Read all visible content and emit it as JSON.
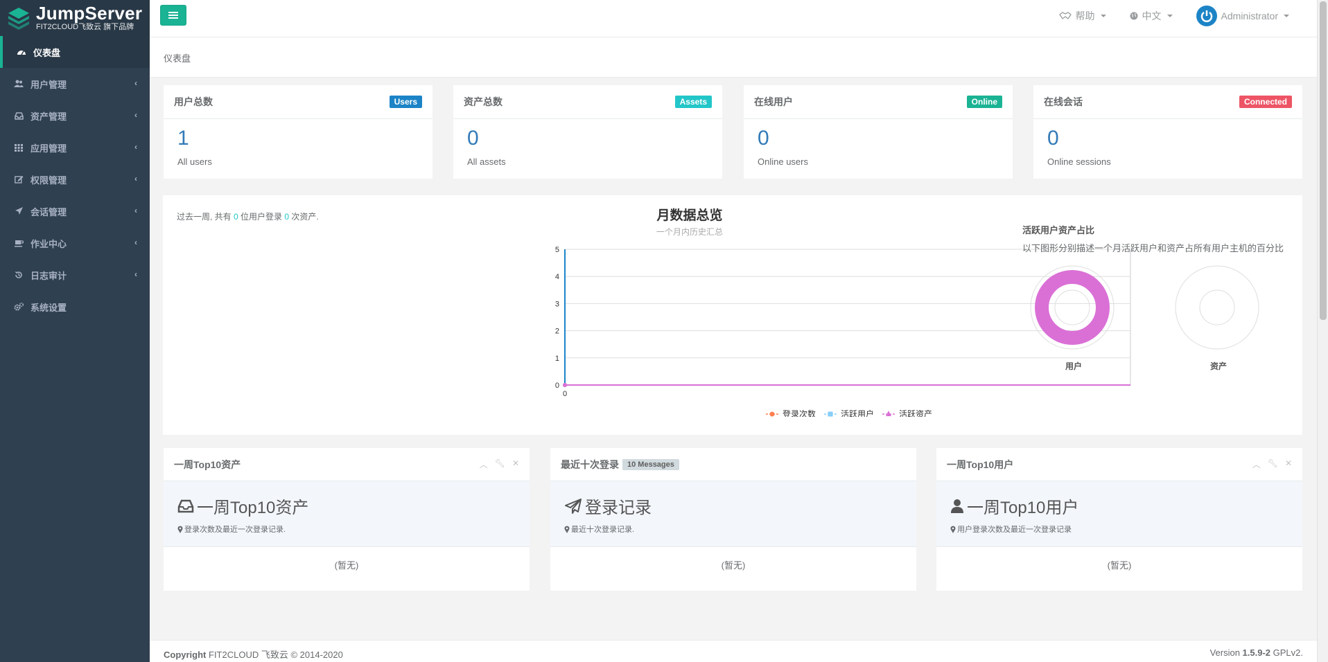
{
  "brand": {
    "title": "JumpServer",
    "subtitle": "FIT2CLOUD飞致云 旗下品牌"
  },
  "sidebar": {
    "items": [
      {
        "label": "仪表盘",
        "icon": "dashboard-icon",
        "active": true
      },
      {
        "label": "用户管理",
        "icon": "users-icon"
      },
      {
        "label": "资产管理",
        "icon": "inbox-icon"
      },
      {
        "label": "应用管理",
        "icon": "grid-icon"
      },
      {
        "label": "权限管理",
        "icon": "edit-icon"
      },
      {
        "label": "会话管理",
        "icon": "rocket-icon"
      },
      {
        "label": "作业中心",
        "icon": "coffee-icon"
      },
      {
        "label": "日志审计",
        "icon": "history-icon"
      },
      {
        "label": "系统设置",
        "icon": "cogs-icon"
      }
    ]
  },
  "topbar": {
    "help": "帮助",
    "language": "中文",
    "user": "Administrator"
  },
  "breadcrumb": "仪表盘",
  "stats": [
    {
      "title": "用户总数",
      "badge": "Users",
      "badge_color": "#1c84c6",
      "value": "1",
      "desc": "All users"
    },
    {
      "title": "资产总数",
      "badge": "Assets",
      "badge_color": "#23c6c8",
      "value": "0",
      "desc": "All assets"
    },
    {
      "title": "在线用户",
      "badge": "Online",
      "badge_color": "#1ab394",
      "value": "0",
      "desc": "Online users"
    },
    {
      "title": "在线会话",
      "badge": "Connected",
      "badge_color": "#ed5565",
      "value": "0",
      "desc": "Online sessions"
    }
  ],
  "summary": {
    "prefix": "过去一周, 共有 ",
    "users": "0",
    "middle": " 位用户登录 ",
    "assets": "0",
    "suffix": " 次资产."
  },
  "chart_data": {
    "type": "line",
    "title": "月数据总览",
    "subtitle": "一个月内历史汇总",
    "x": [
      "0"
    ],
    "ylim": [
      0,
      5
    ],
    "yticks": [
      0,
      1,
      2,
      3,
      4,
      5
    ],
    "grid": true,
    "legend": "bottom",
    "series": [
      {
        "name": "登录次数",
        "values": [
          0
        ],
        "color": "#ff7f50"
      },
      {
        "name": "活跃用户",
        "values": [
          0
        ],
        "color": "#87cefa"
      },
      {
        "name": "活跃资产",
        "values": [
          0
        ],
        "color": "#da70d6"
      }
    ]
  },
  "ratio": {
    "title": "活跃用户资产占比",
    "subtitle": "以下图形分别描述一个月活跃用户和资产占所有用户主机的百分比",
    "donuts": [
      {
        "label": "用户",
        "fill_fraction": 1.0,
        "color": "#da70d6"
      },
      {
        "label": "资产",
        "fill_fraction": 0.0,
        "color": "#da70d6"
      }
    ]
  },
  "panels": [
    {
      "title": "一周Top10资产",
      "hero": "一周Top10资产",
      "hero_icon": "inbox-icon",
      "sub": "登录次数及最近一次登录记录.",
      "empty": "(暂无)",
      "tools": true
    },
    {
      "title": "最近十次登录",
      "badge": "10 Messages",
      "hero": "登录记录",
      "hero_icon": "paper-plane-icon",
      "sub": "最近十次登录记录.",
      "empty": "(暂无)",
      "tools": false
    },
    {
      "title": "一周Top10用户",
      "hero": "一周Top10用户",
      "hero_icon": "user-icon",
      "sub": "用户登录次数及最近一次登录记录",
      "empty": "(暂无)",
      "tools": true
    }
  ],
  "footer": {
    "copyright_bold": "Copyright",
    "copyright": " FIT2CLOUD 飞致云 © 2014-2020",
    "version_prefix": "Version ",
    "version": "1.5.9-2",
    "version_suffix": " GPLv2."
  }
}
